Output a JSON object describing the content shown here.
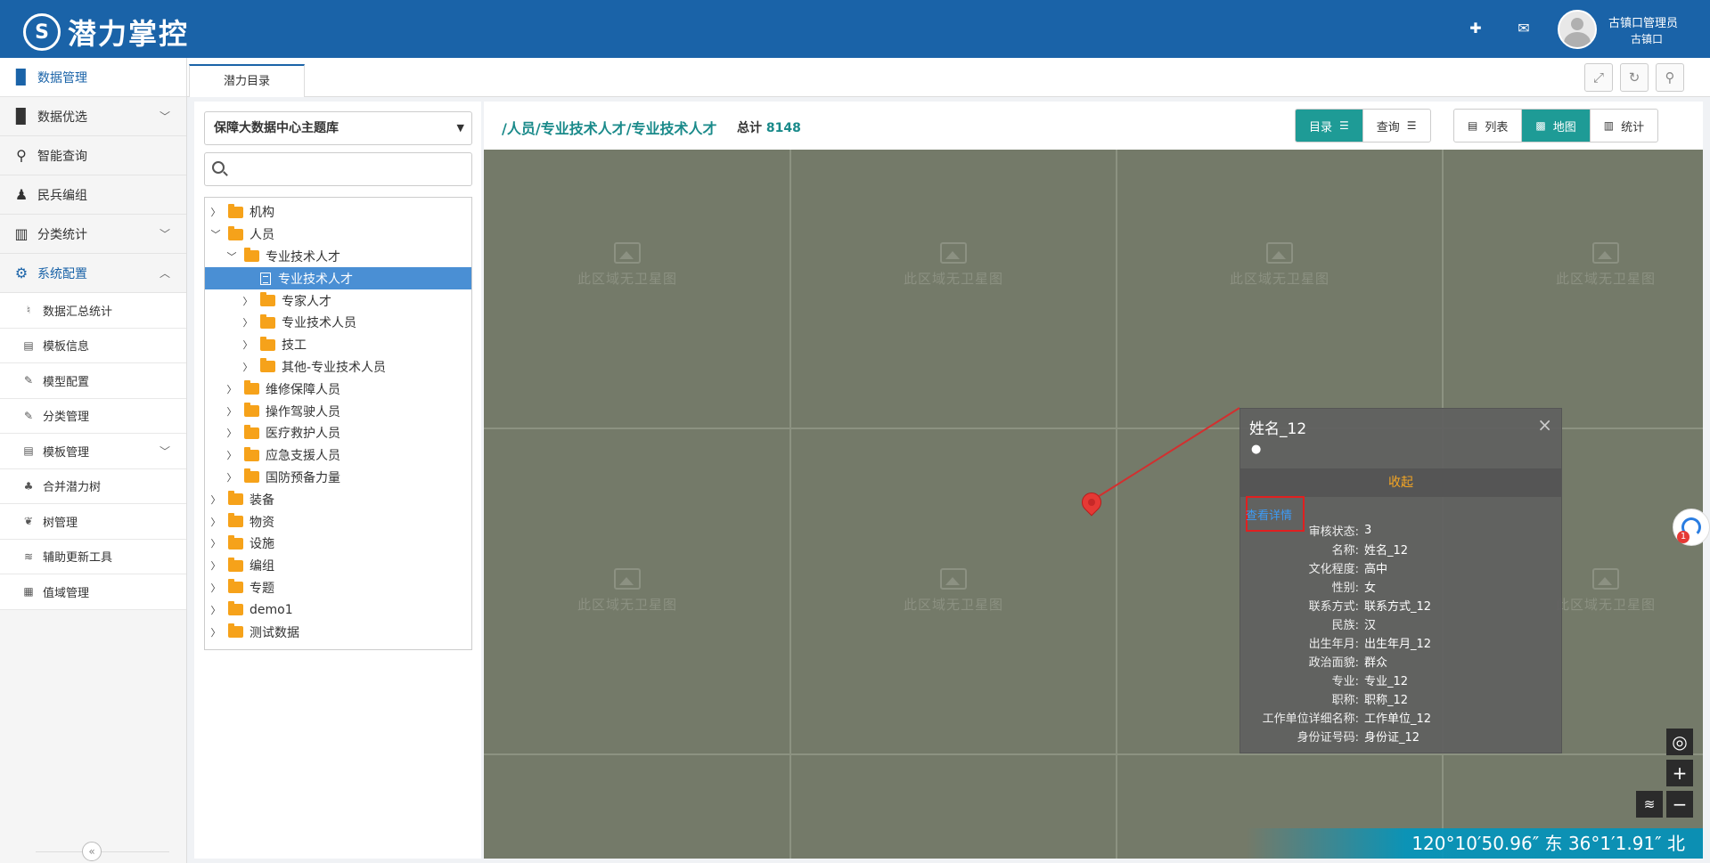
{
  "header": {
    "logo_text": "潜力掌控",
    "user_name": "古镇口管理员",
    "user_org": "古镇口"
  },
  "sidebar": {
    "items": [
      {
        "label": "数据管理",
        "icon": "book-icon"
      },
      {
        "label": "数据优选",
        "icon": "book-icon"
      },
      {
        "label": "智能查询",
        "icon": "search-icon"
      },
      {
        "label": "民兵编组",
        "icon": "users-icon"
      },
      {
        "label": "分类统计",
        "icon": "bar-chart-icon"
      },
      {
        "label": "系统配置",
        "icon": "gear-icon"
      }
    ],
    "sub_items": [
      {
        "label": "数据汇总统计",
        "icon": "bell-icon"
      },
      {
        "label": "模板信息",
        "icon": "table-icon"
      },
      {
        "label": "模型配置",
        "icon": "wrench-icon"
      },
      {
        "label": "分类管理",
        "icon": "wrench-icon"
      },
      {
        "label": "模板管理",
        "icon": "table-icon"
      },
      {
        "label": "合并潜力树",
        "icon": "tree-icon"
      },
      {
        "label": "树管理",
        "icon": "leaf-icon"
      },
      {
        "label": "辅助更新工具",
        "icon": "layers-icon"
      },
      {
        "label": "值域管理",
        "icon": "grid-icon"
      }
    ]
  },
  "tabs": [
    {
      "label": "潜力目录"
    }
  ],
  "left_panel": {
    "selected_library": "保障大数据中心主题库",
    "search_value": "",
    "tree": [
      "机构",
      "人员",
      "专业技术人才",
      "专业技术人才",
      "专家人才",
      "专业技术人员",
      "技工",
      "其他-专业技术人员",
      "维修保障人员",
      "操作驾驶人员",
      "医疗救护人员",
      "应急支援人员",
      "国防预备力量",
      "装备",
      "物资",
      "设施",
      "编组",
      "专题",
      "demo1",
      "测试数据"
    ]
  },
  "main": {
    "breadcrumb": "/人员/专业技术人才/专业技术人才",
    "total_label": "总计",
    "total_value": "8148",
    "buttons": {
      "catalog": "目录",
      "query": "查询",
      "list": "列表",
      "map": "地图",
      "stats": "统计"
    }
  },
  "map": {
    "tile_placeholder": "此区域无卫星图",
    "coords": "120°10′50.96″ 东  36°1′1.91″ 北",
    "popup": {
      "title": "姓名_12",
      "collapse": "收起",
      "detail_link": "查看详情",
      "fields": [
        {
          "label": "审核状态:",
          "value": "3"
        },
        {
          "label": "名称:",
          "value": "姓名_12"
        },
        {
          "label": "文化程度:",
          "value": "高中"
        },
        {
          "label": "性别:",
          "value": "女"
        },
        {
          "label": "联系方式:",
          "value": "联系方式_12"
        },
        {
          "label": "民族:",
          "value": "汉"
        },
        {
          "label": "出生年月:",
          "value": "出生年月_12"
        },
        {
          "label": "政治面貌:",
          "value": "群众"
        },
        {
          "label": "专业:",
          "value": "专业_12"
        },
        {
          "label": "职称:",
          "value": "职称_12"
        },
        {
          "label": "工作单位详细名称:",
          "value": "工作单位_12"
        },
        {
          "label": "身份证号码:",
          "value": "身份证_12"
        }
      ]
    },
    "badge_count": "1"
  }
}
